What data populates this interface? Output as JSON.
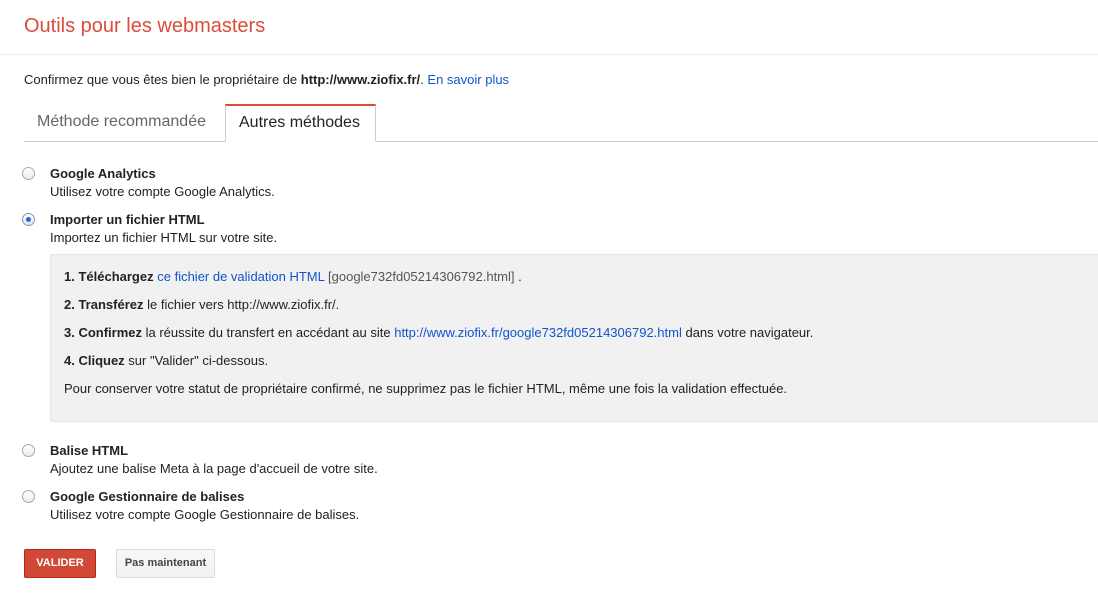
{
  "header": {
    "title": "Outils pour les webmasters"
  },
  "intro": {
    "text": "Confirmez que vous êtes bien le propriétaire de ",
    "site": "http://www.ziofix.fr/",
    "punct": ". ",
    "learn_more": "En savoir plus"
  },
  "tabs": [
    {
      "label": "Méthode recommandée",
      "active": false
    },
    {
      "label": "Autres méthodes",
      "active": true
    }
  ],
  "options": [
    {
      "title": "Google Analytics",
      "desc": "Utilisez votre compte Google Analytics.",
      "checked": false
    },
    {
      "title": "Importer un fichier HTML",
      "desc": "Importez un fichier HTML sur votre site.",
      "checked": true
    },
    {
      "title": "Balise HTML",
      "desc": "Ajoutez une balise Meta à la page d'accueil de votre site.",
      "checked": false
    },
    {
      "title": "Google Gestionnaire de balises",
      "desc": "Utilisez votre compte Google Gestionnaire de balises.",
      "checked": false
    }
  ],
  "steps": {
    "step1_bold": "1. Téléchargez",
    "step1_link": "ce fichier de validation HTML",
    "step1_file": "[google732fd05214306792.html]",
    "step1_end": " .",
    "step2_bold": "2. Transférez",
    "step2_text": " le fichier vers http://www.ziofix.fr/.",
    "step3_bold": "3. Confirmez",
    "step3_text": " la réussite du transfert en accédant au site ",
    "step3_link": "http://www.ziofix.fr/google732fd05214306792.html",
    "step3_end": " dans votre navigateur.",
    "step4_bold": "4. Cliquez",
    "step4_text": " sur \"Valider\" ci-dessous.",
    "note": "Pour conserver votre statut de propriétaire confirmé, ne supprimez pas le fichier HTML, même une fois la validation effectuée."
  },
  "buttons": {
    "validate": "VALIDER",
    "not_now": "Pas maintenant"
  },
  "colors": {
    "accent": "#dd4b39",
    "link": "#1155cc",
    "primary_button": "#d14836"
  }
}
